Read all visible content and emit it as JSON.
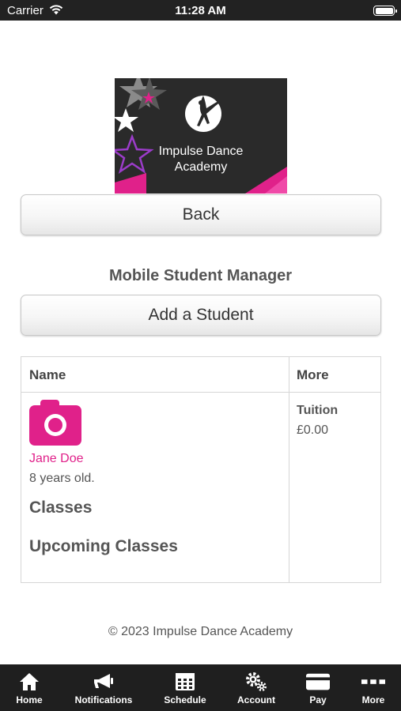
{
  "status_bar": {
    "carrier": "Carrier",
    "time": "11:28 AM"
  },
  "logo": {
    "line1": "Impulse Dance",
    "line2": "Academy",
    "brand_color": "#e0218a"
  },
  "buttons": {
    "back": "Back",
    "add_student": "Add a Student"
  },
  "page_title": "Mobile Student Manager",
  "table": {
    "headers": {
      "name": "Name",
      "more": "More"
    },
    "student": {
      "name": "Jane Doe",
      "age": "8 years old.",
      "classes_heading": "Classes",
      "upcoming_heading": "Upcoming Classes",
      "tuition_label": "Tuition",
      "tuition_value": "£0.00"
    }
  },
  "footer": "© 2023 Impulse Dance Academy",
  "tabs": [
    {
      "label": "Home",
      "icon": "home-icon"
    },
    {
      "label": "Notifications",
      "icon": "megaphone-icon"
    },
    {
      "label": "Schedule",
      "icon": "calendar-icon"
    },
    {
      "label": "Account",
      "icon": "gears-icon"
    },
    {
      "label": "Pay",
      "icon": "credit-card-icon"
    },
    {
      "label": "More",
      "icon": "more-dots-icon"
    }
  ]
}
